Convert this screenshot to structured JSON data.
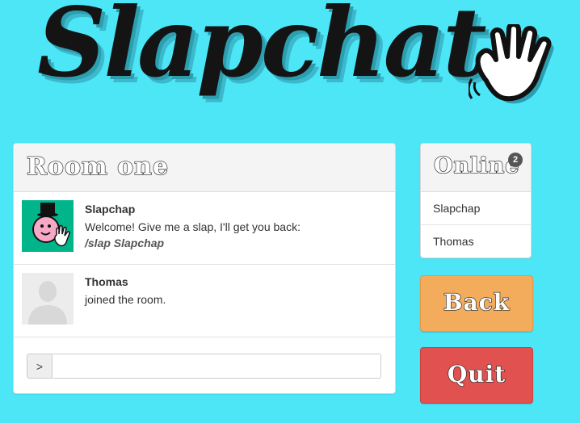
{
  "logo": {
    "text": "Slapchat",
    "icon": "waving-hand-icon"
  },
  "room": {
    "title": "Room one",
    "messages": [
      {
        "name": "Slapchap",
        "avatar": "bot-avatar",
        "text": "Welcome! Give me a slap, I'll get you back:",
        "command": "/slap Slapchap"
      },
      {
        "name": "Thomas",
        "avatar": "default-user-avatar",
        "text": "joined the room."
      }
    ],
    "input": {
      "prompt": ">",
      "value": "",
      "placeholder": ""
    }
  },
  "online": {
    "title": "Online",
    "count": "2",
    "users": [
      "Slapchap",
      "Thomas"
    ]
  },
  "buttons": {
    "back": "Back",
    "quit": "Quit"
  },
  "colors": {
    "background": "#4de6f7",
    "back_button": "#f2ac5c",
    "quit_button": "#e0514f",
    "bot_avatar_bg": "#00b58a"
  }
}
